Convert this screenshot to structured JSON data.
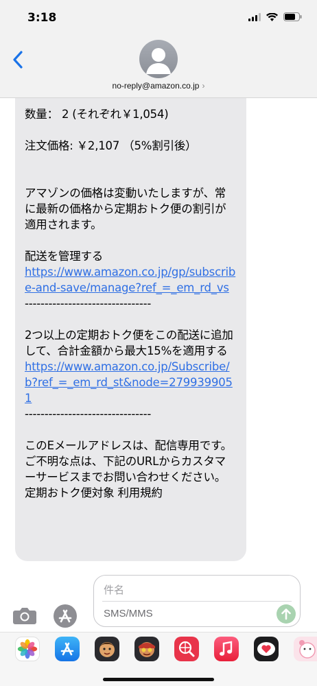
{
  "status_bar": {
    "time": "3:18"
  },
  "header": {
    "contact": "no-reply@amazon.co.jp",
    "chevron": "›"
  },
  "message": {
    "quantity": "数量： 2 (それぞれ￥1,054)",
    "order_price": "注文価格: ￥2,107 （5%割引後）",
    "price_note": "アマゾンの価格は変動いたしますが、常に最新の価格から定期おトク便の割引が適用されます。",
    "manage_label": "配送を管理する",
    "manage_link": "https://www.amazon.co.jp/gp/subscribe-and-save/manage?ref_=_em_rd_vs",
    "separator1": "--------------------------------",
    "add_note": "2つ以上の定期おトク便をこの配送に追加して、合計金額から最大15%を適用する",
    "add_link": "https://www.amazon.co.jp/Subscribe/b?ref_=_em_rd_st&node=2799399051",
    "separator2": "--------------------------------",
    "footer_note": "このEメールアドレスは、配信専用です。ご不明な点は、下記のURLからカスタマーサービスまでお問い合わせください。 定期おトク便対象 利用規約"
  },
  "composer": {
    "subject_placeholder": "件名",
    "body_placeholder": "SMS/MMS"
  },
  "colors": {
    "link": "#2f6fe4",
    "bubble": "#e9e9eb",
    "back": "#1a73e8",
    "send": "#a9d3b0"
  },
  "icons": [
    "back-chevron-icon",
    "contact-avatar-icon",
    "camera-icon",
    "app-store-icon",
    "photos-icon",
    "memoji-icon",
    "music-icon",
    "heart-message-icon"
  ]
}
